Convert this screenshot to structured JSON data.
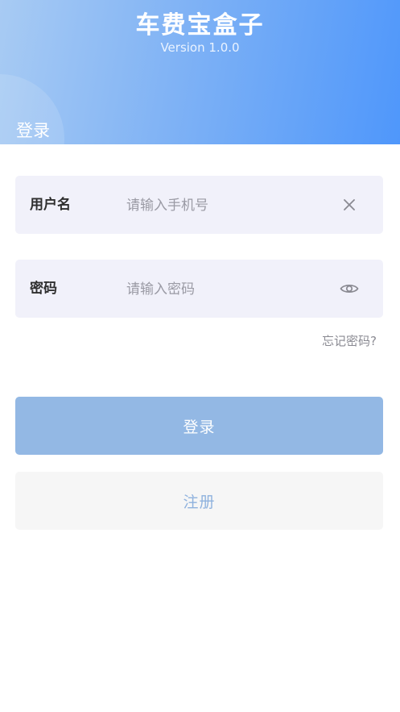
{
  "header": {
    "app_title": "车费宝盒子",
    "version": "Version 1.0.0",
    "tab": "登录"
  },
  "form": {
    "username": {
      "label": "用户名",
      "placeholder": "请输入手机号",
      "value": "",
      "icon": "clear-icon"
    },
    "password": {
      "label": "密码",
      "placeholder": "请输入密码",
      "value": "",
      "icon": "eye-icon"
    },
    "forgot_password": "忘记密码?"
  },
  "buttons": {
    "login": "登录",
    "register": "注册"
  },
  "colors": {
    "header_start": "#a8cbf3",
    "header_end": "#4f97fb",
    "login_button": "#93b8e4",
    "register_text": "#8fb2de",
    "field_bg": "#f1f1fa"
  }
}
